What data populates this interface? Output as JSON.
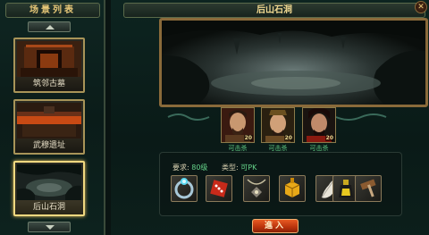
{
  "left_panel": {
    "title": "场景列表",
    "scenes": [
      {
        "label": "筑邻古墓"
      },
      {
        "label": "武穆遗址"
      },
      {
        "label": "后山石洞"
      }
    ]
  },
  "right_panel": {
    "title": "后山石洞",
    "bosses": [
      {
        "level": "20",
        "caption": "可击杀"
      },
      {
        "level": "20",
        "caption": "可击杀"
      },
      {
        "level": "20",
        "caption": "可击杀"
      }
    ],
    "requirements": {
      "level_key": "要求:",
      "level_val": "80级",
      "type_key": "类型:",
      "type_val": "可PK"
    },
    "items": [
      {
        "icon": "gem-ring-icon"
      },
      {
        "icon": "dice-icon"
      },
      {
        "icon": "chain-pendant-icon"
      },
      {
        "icon": "gold-box-icon"
      },
      {
        "icon": "feather-icon"
      },
      {
        "icon": "potion-icon"
      },
      {
        "icon": "hammer-icon"
      }
    ],
    "enter_label": "進入"
  }
}
